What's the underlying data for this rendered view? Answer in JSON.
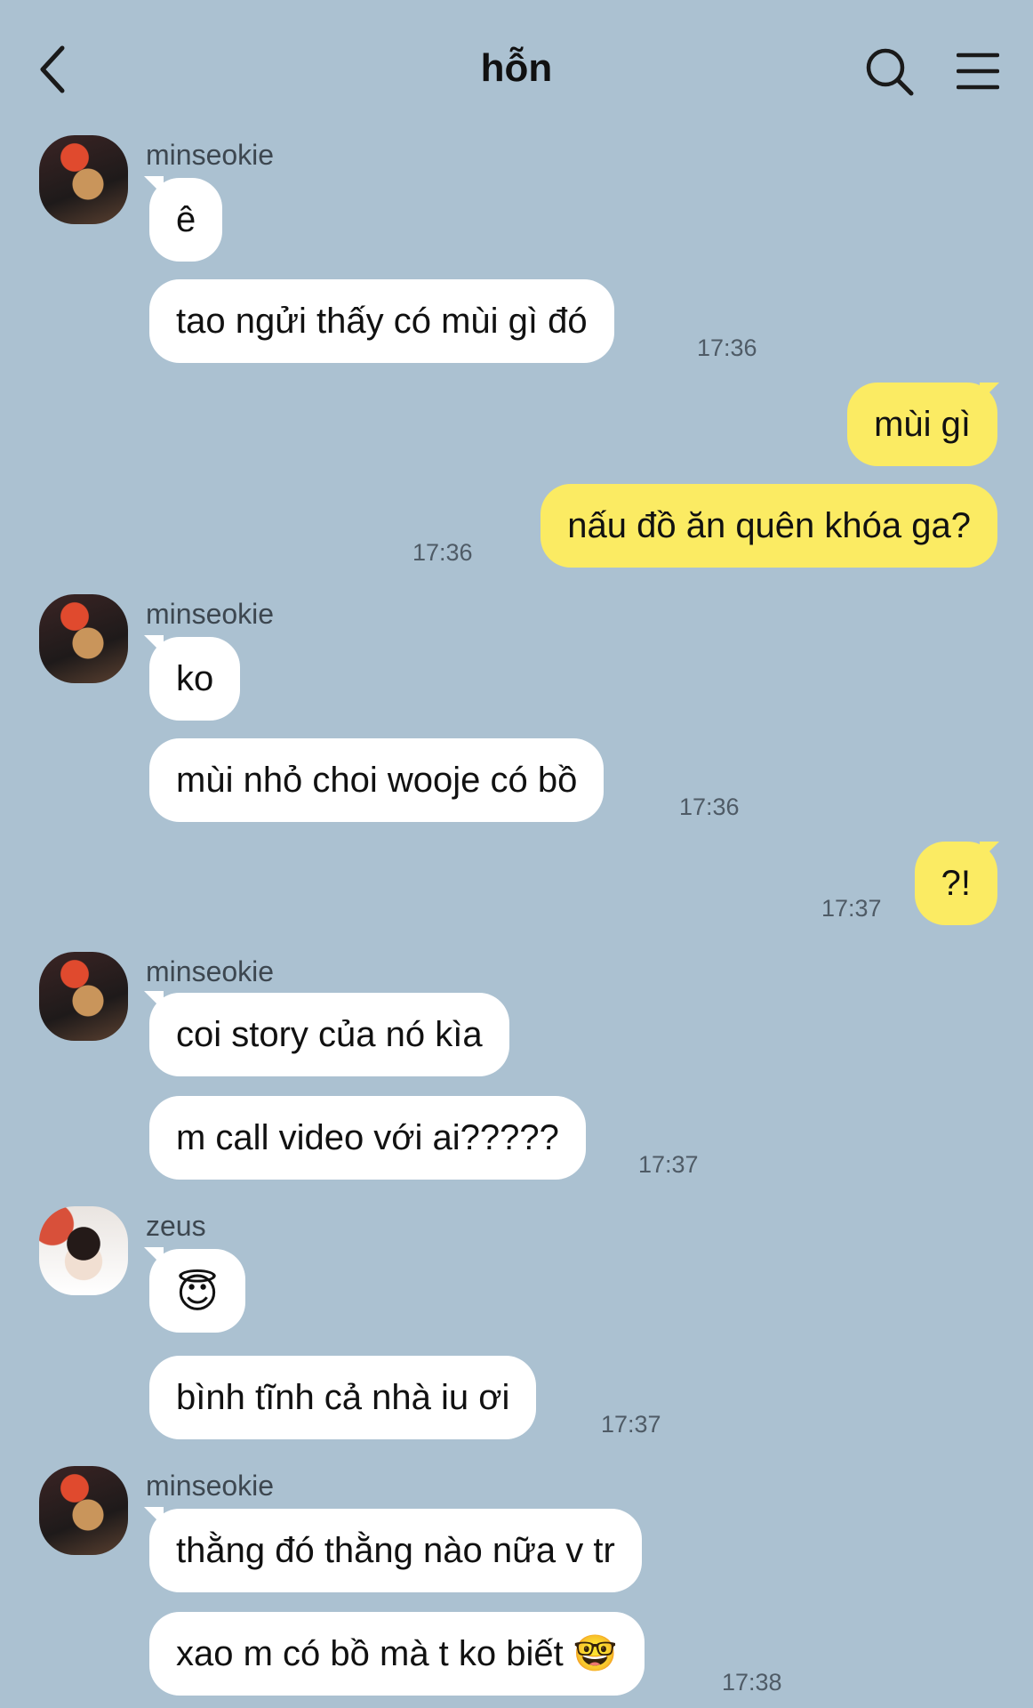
{
  "header": {
    "title": "hỗn"
  },
  "messages": [
    {
      "sender": "minseokie",
      "bubbles": [
        "ê",
        "tao ngửi thấy có mùi gì đó"
      ],
      "time": "17:36"
    },
    {
      "sender": "me",
      "bubbles": [
        "mùi gì",
        "nấu đồ ăn quên khóa ga?"
      ],
      "time": "17:36"
    },
    {
      "sender": "minseokie",
      "bubbles": [
        "ko",
        "mùi nhỏ choi wooje có bồ"
      ],
      "time": "17:36"
    },
    {
      "sender": "me",
      "bubbles": [
        "?!"
      ],
      "time": "17:37"
    },
    {
      "sender": "minseokie",
      "bubbles": [
        "coi story của nó kìa",
        "m call video với ai?????"
      ],
      "time": "17:37"
    },
    {
      "sender": "zeus",
      "bubbles": [
        "😇",
        "bình tĩnh cả nhà iu ơi"
      ],
      "time": "17:37"
    },
    {
      "sender": "minseokie",
      "bubbles": [
        "thằng đó thằng nào nữa v tr",
        "xao m có bồ mà t ko biết 🤓"
      ],
      "time": "17:38"
    }
  ],
  "icons": {
    "back": "chevron-left-icon",
    "search": "search-icon",
    "menu": "menu-icon"
  },
  "colors": {
    "background": "#abc1d1",
    "my_bubble": "#fbeb63",
    "their_bubble": "#ffffff"
  }
}
